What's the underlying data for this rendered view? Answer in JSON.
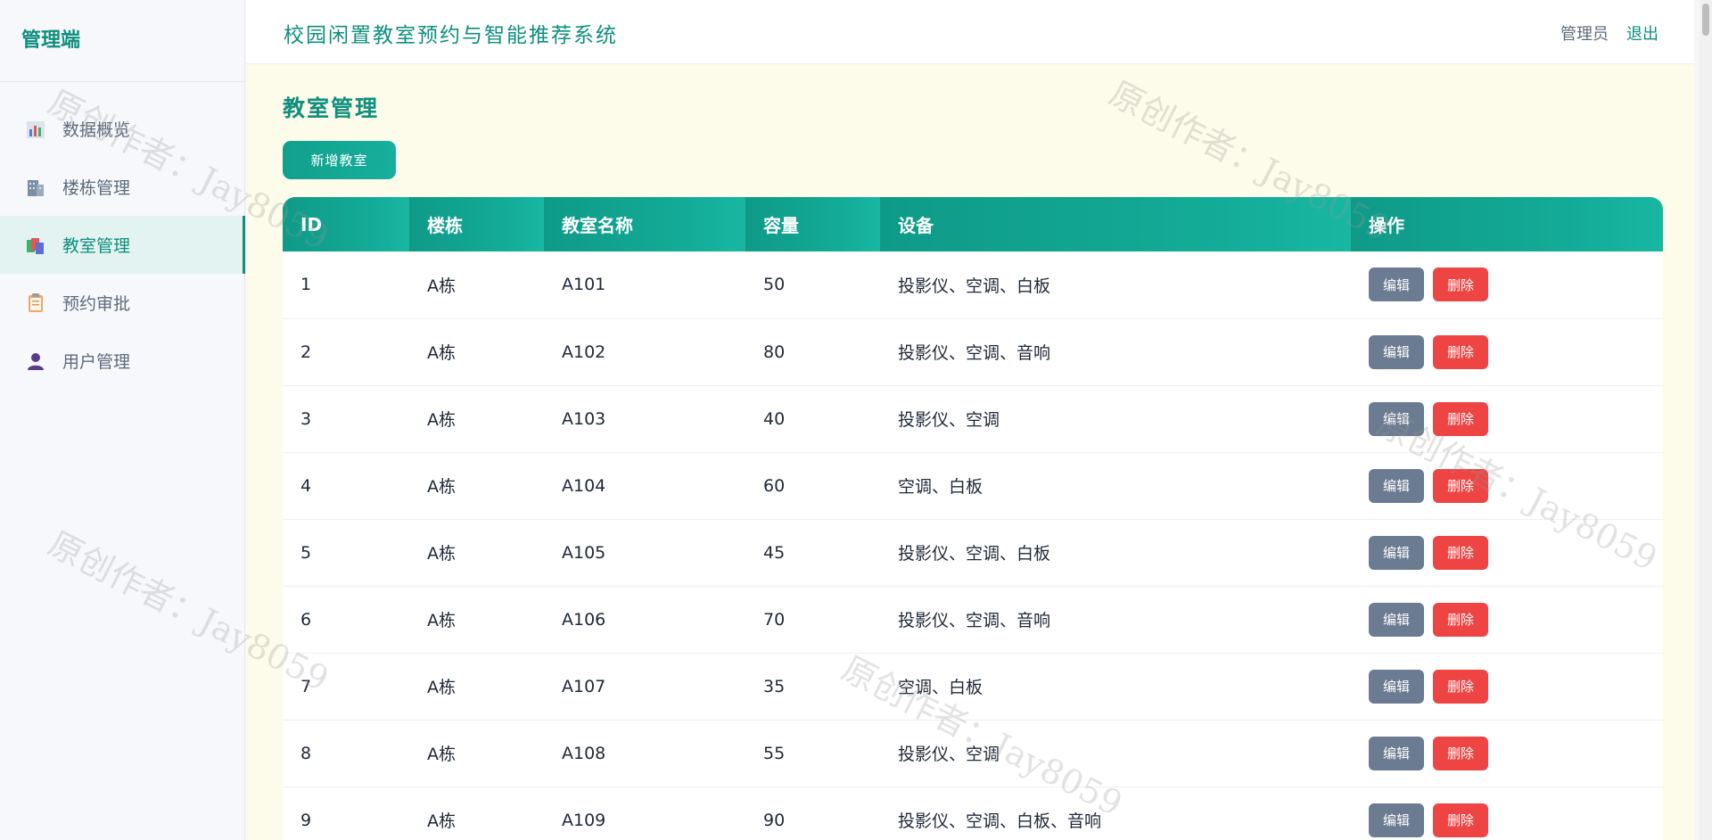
{
  "sidebar": {
    "brand": "管理端",
    "items": [
      {
        "label": "数据概览",
        "icon": "bar-chart-icon",
        "active": false
      },
      {
        "label": "楼栋管理",
        "icon": "building-icon",
        "active": false
      },
      {
        "label": "教室管理",
        "icon": "classroom-icon",
        "active": true
      },
      {
        "label": "预约审批",
        "icon": "clipboard-icon",
        "active": false
      },
      {
        "label": "用户管理",
        "icon": "user-icon",
        "active": false
      }
    ]
  },
  "header": {
    "title": "校园闲置教室预约与智能推荐系统",
    "user": "管理员",
    "logout": "退出"
  },
  "main": {
    "title": "教室管理",
    "add_button": "新增教室",
    "table": {
      "headers": [
        "ID",
        "楼栋",
        "教室名称",
        "容量",
        "设备",
        "操作"
      ],
      "edit_label": "编辑",
      "delete_label": "删除",
      "rows": [
        {
          "id": "1",
          "building": "A栋",
          "name": "A101",
          "capacity": "50",
          "equipment": "投影仪、空调、白板"
        },
        {
          "id": "2",
          "building": "A栋",
          "name": "A102",
          "capacity": "80",
          "equipment": "投影仪、空调、音响"
        },
        {
          "id": "3",
          "building": "A栋",
          "name": "A103",
          "capacity": "40",
          "equipment": "投影仪、空调"
        },
        {
          "id": "4",
          "building": "A栋",
          "name": "A104",
          "capacity": "60",
          "equipment": "空调、白板"
        },
        {
          "id": "5",
          "building": "A栋",
          "name": "A105",
          "capacity": "45",
          "equipment": "投影仪、空调、白板"
        },
        {
          "id": "6",
          "building": "A栋",
          "name": "A106",
          "capacity": "70",
          "equipment": "投影仪、空调、音响"
        },
        {
          "id": "7",
          "building": "A栋",
          "name": "A107",
          "capacity": "35",
          "equipment": "空调、白板"
        },
        {
          "id": "8",
          "building": "A栋",
          "name": "A108",
          "capacity": "55",
          "equipment": "投影仪、空调"
        },
        {
          "id": "9",
          "building": "A栋",
          "name": "A109",
          "capacity": "90",
          "equipment": "投影仪、空调、白板、音响"
        }
      ]
    }
  },
  "watermark": "原创作者：Jay8059",
  "colors": {
    "accent": "#0f8f7e",
    "delete": "#ef4444",
    "edit": "#6b7b91",
    "content_bg": "#fdfbe9"
  }
}
